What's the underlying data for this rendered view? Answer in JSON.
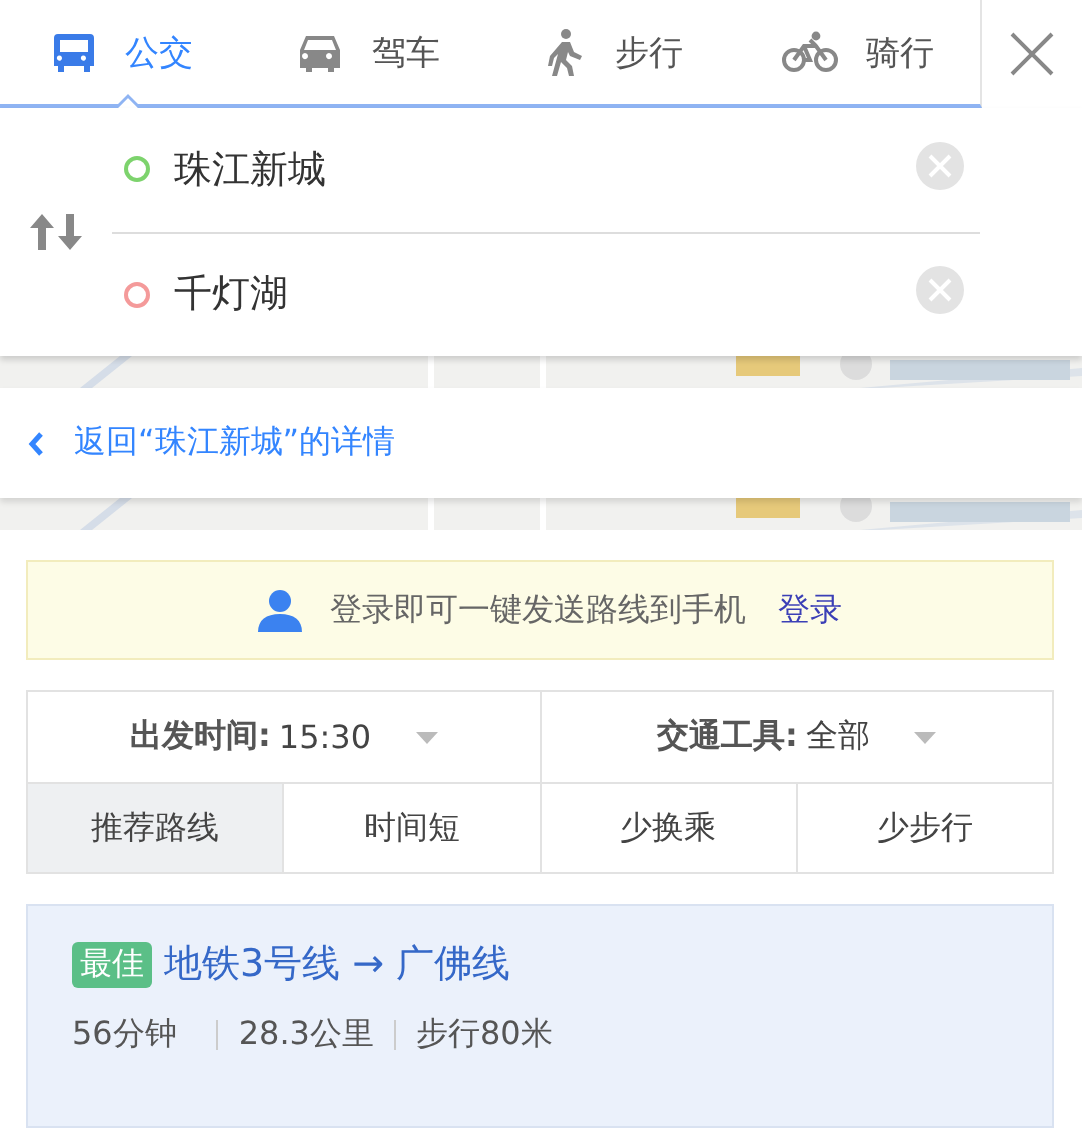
{
  "tabs": [
    {
      "label": "公交",
      "selected": true
    },
    {
      "label": "驾车",
      "selected": false
    },
    {
      "label": "步行",
      "selected": false
    },
    {
      "label": "骑行",
      "selected": false
    }
  ],
  "stops": [
    {
      "value": "珠江新城",
      "color": "#7dd36d"
    },
    {
      "value": "千灯湖",
      "color": "#f49a9a"
    }
  ],
  "back_link": "返回“珠江新城”的详情",
  "login_banner": {
    "message": "登录即可一键发送路线到手机",
    "link": "登录"
  },
  "filters": [
    {
      "label": "出发时间:",
      "value": "15:30"
    },
    {
      "label": "交通工具:",
      "value": "全部"
    }
  ],
  "sort_tabs": [
    {
      "label": "推荐路线",
      "selected": true
    },
    {
      "label": "时间短",
      "selected": false
    },
    {
      "label": "少换乘",
      "selected": false
    },
    {
      "label": "少步行",
      "selected": false
    }
  ],
  "routes": [
    {
      "badge": "最佳",
      "title": "地铁3号线 → 广佛线",
      "duration": "56分钟",
      "distance": "28.3公里",
      "walk": "步行80米"
    }
  ]
}
